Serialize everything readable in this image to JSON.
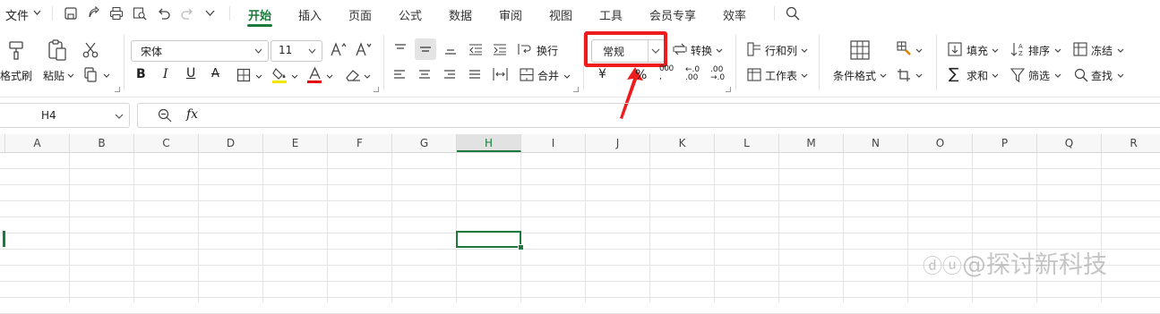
{
  "menu": {
    "file_label": "文件",
    "tabs": [
      "开始",
      "插入",
      "页面",
      "公式",
      "数据",
      "审阅",
      "视图",
      "工具",
      "会员专享",
      "效率"
    ],
    "active_tab": "开始"
  },
  "ribbon": {
    "clipboard": {
      "format_painter": "格式刷",
      "paste": "粘贴"
    },
    "font": {
      "name": "宋体",
      "size": "11"
    },
    "align": {
      "wrap": "换行",
      "merge": "合并"
    },
    "number": {
      "format_value": "常规",
      "convert": "转换",
      "percent_symbol": "%"
    },
    "rows_cols": {
      "rows_cols": "行和列",
      "worksheet": "工作表"
    },
    "cond_format": "条件格式",
    "editing": {
      "fill": "填充",
      "sort": "排序",
      "freeze": "冻结",
      "sum": "求和",
      "filter": "筛选",
      "find": "查找"
    }
  },
  "formula_bar": {
    "cell_ref": "H4",
    "fx": "fx",
    "formula": ""
  },
  "grid": {
    "columns": [
      "A",
      "B",
      "C",
      "D",
      "E",
      "F",
      "G",
      "H",
      "I",
      "J",
      "K",
      "L",
      "M",
      "N",
      "O",
      "P",
      "Q",
      "R"
    ],
    "selected_column": "H",
    "selected_cell": "H4"
  },
  "watermark": "@探讨新科技",
  "colors": {
    "accent": "#1b7a3c",
    "highlight": "#ee1c1c"
  }
}
